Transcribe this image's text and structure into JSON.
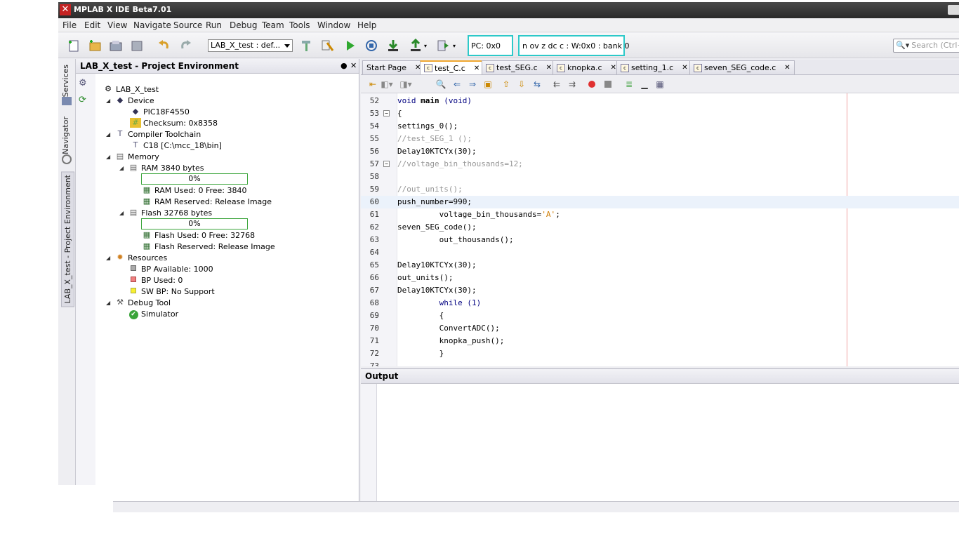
{
  "window": {
    "title": "MPLAB X IDE Beta7.01"
  },
  "menu": [
    "File",
    "Edit",
    "View",
    "Navigate",
    "Source",
    "Run",
    "Debug",
    "Team",
    "Tools",
    "Window",
    "Help"
  ],
  "toolbar": {
    "config": "LAB_X_test : def...",
    "pc": "PC: 0x0",
    "flags": "n ov z dc c  : W:0x0 : bank 0",
    "search_placeholder": "Search (Ctrl+"
  },
  "side_tabs": [
    "Services",
    "Navigator",
    "LAB_X_test - Project Environment"
  ],
  "project_panel": {
    "title": "LAB_X_test - Project Environment",
    "tree": {
      "root": "LAB_X_test",
      "device": "Device",
      "device_name": "PIC18F4550",
      "checksum": "Checksum: 0x8358",
      "compiler": "Compiler Toolchain",
      "compiler_path": "C18 [C:\\mcc_18\\bin]",
      "memory": "Memory",
      "ram": "RAM 3840 bytes",
      "ram_progress": "0%",
      "ram_used": "RAM Used: 0 Free: 3840",
      "ram_reserved": "RAM Reserved: Release Image",
      "flash": "Flash 32768 bytes",
      "flash_progress": "0%",
      "flash_used": "Flash Used: 0 Free: 32768",
      "flash_reserved": "Flash Reserved: Release Image",
      "resources": "Resources",
      "bp_available": "BP Available: 1000",
      "bp_used": "BP Used: 0",
      "sw_bp": "SW BP: No Support",
      "debug_tool": "Debug Tool",
      "simulator": "Simulator"
    }
  },
  "editor_tabs": [
    "Start Page",
    "test_C.c",
    "test_SEG.c",
    "knopka.c",
    "setting_1.c",
    "seven_SEG_code.c"
  ],
  "active_tab": "test_C.c",
  "code": [
    {
      "n": "52",
      "t": "void main (void)"
    },
    {
      "n": "53",
      "t": "{"
    },
    {
      "n": "54",
      "t": "settings_0();"
    },
    {
      "n": "55",
      "t": "//test_SEG_1 ();"
    },
    {
      "n": "56",
      "t": "Delay10KTCYx(30);"
    },
    {
      "n": "57",
      "t": "//voltage_bin_thousands=12;"
    },
    {
      "n": "58",
      "t": ""
    },
    {
      "n": "59",
      "t": "//out_units();"
    },
    {
      "n": "60",
      "t": "push_number=990;"
    },
    {
      "n": "61",
      "t": "         voltage_bin_thousands='A';"
    },
    {
      "n": "62",
      "t": "seven_SEG_code();"
    },
    {
      "n": "63",
      "t": "         out_thousands();"
    },
    {
      "n": "64",
      "t": ""
    },
    {
      "n": "65",
      "t": "Delay10KTCYx(30);"
    },
    {
      "n": "66",
      "t": "out_units();"
    },
    {
      "n": "67",
      "t": "Delay10KTCYx(30);"
    },
    {
      "n": "68",
      "t": "         while (1)"
    },
    {
      "n": "69",
      "t": "         {"
    },
    {
      "n": "70",
      "t": "         ConvertADC();"
    },
    {
      "n": "71",
      "t": "         knopka_push();"
    },
    {
      "n": "72",
      "t": "         }"
    },
    {
      "n": "73",
      "t": ""
    }
  ],
  "output": {
    "title": "Output"
  }
}
